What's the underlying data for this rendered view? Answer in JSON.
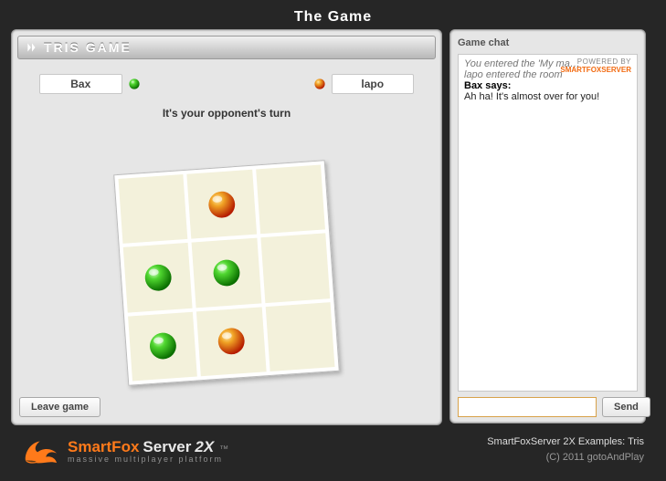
{
  "header": {
    "title": "The Game"
  },
  "game": {
    "title": "TRIS GAME",
    "player1": "Bax",
    "player2": "lapo",
    "status": "It's your opponent's turn",
    "board": [
      "",
      "red",
      "",
      "green",
      "green",
      "",
      "green",
      "red",
      ""
    ],
    "leave_label": "Leave game"
  },
  "chat": {
    "title": "Game chat",
    "messages": [
      {
        "type": "system",
        "text": "You entered the 'My ma…"
      },
      {
        "type": "system",
        "text": "lapo entered the room"
      },
      {
        "type": "speaker",
        "text": "Bax says:"
      },
      {
        "type": "msg",
        "text": "Ah ha! It's almost over for you!"
      }
    ],
    "send_label": "Send",
    "input_placeholder": ""
  },
  "powered": {
    "line1": "POWERED BY",
    "line2": "SMARTFOXSERVER"
  },
  "footer": {
    "brand1": "SmartFox",
    "brand2": "Server",
    "brand3": "2X",
    "tm": "™",
    "tagline": "massive multiplayer platform",
    "credits1": "SmartFoxServer 2X Examples: Tris",
    "credits2": "(C) 2011 gotoAndPlay"
  },
  "colors": {
    "green": "#2fb81f",
    "red": "#e06a12"
  }
}
